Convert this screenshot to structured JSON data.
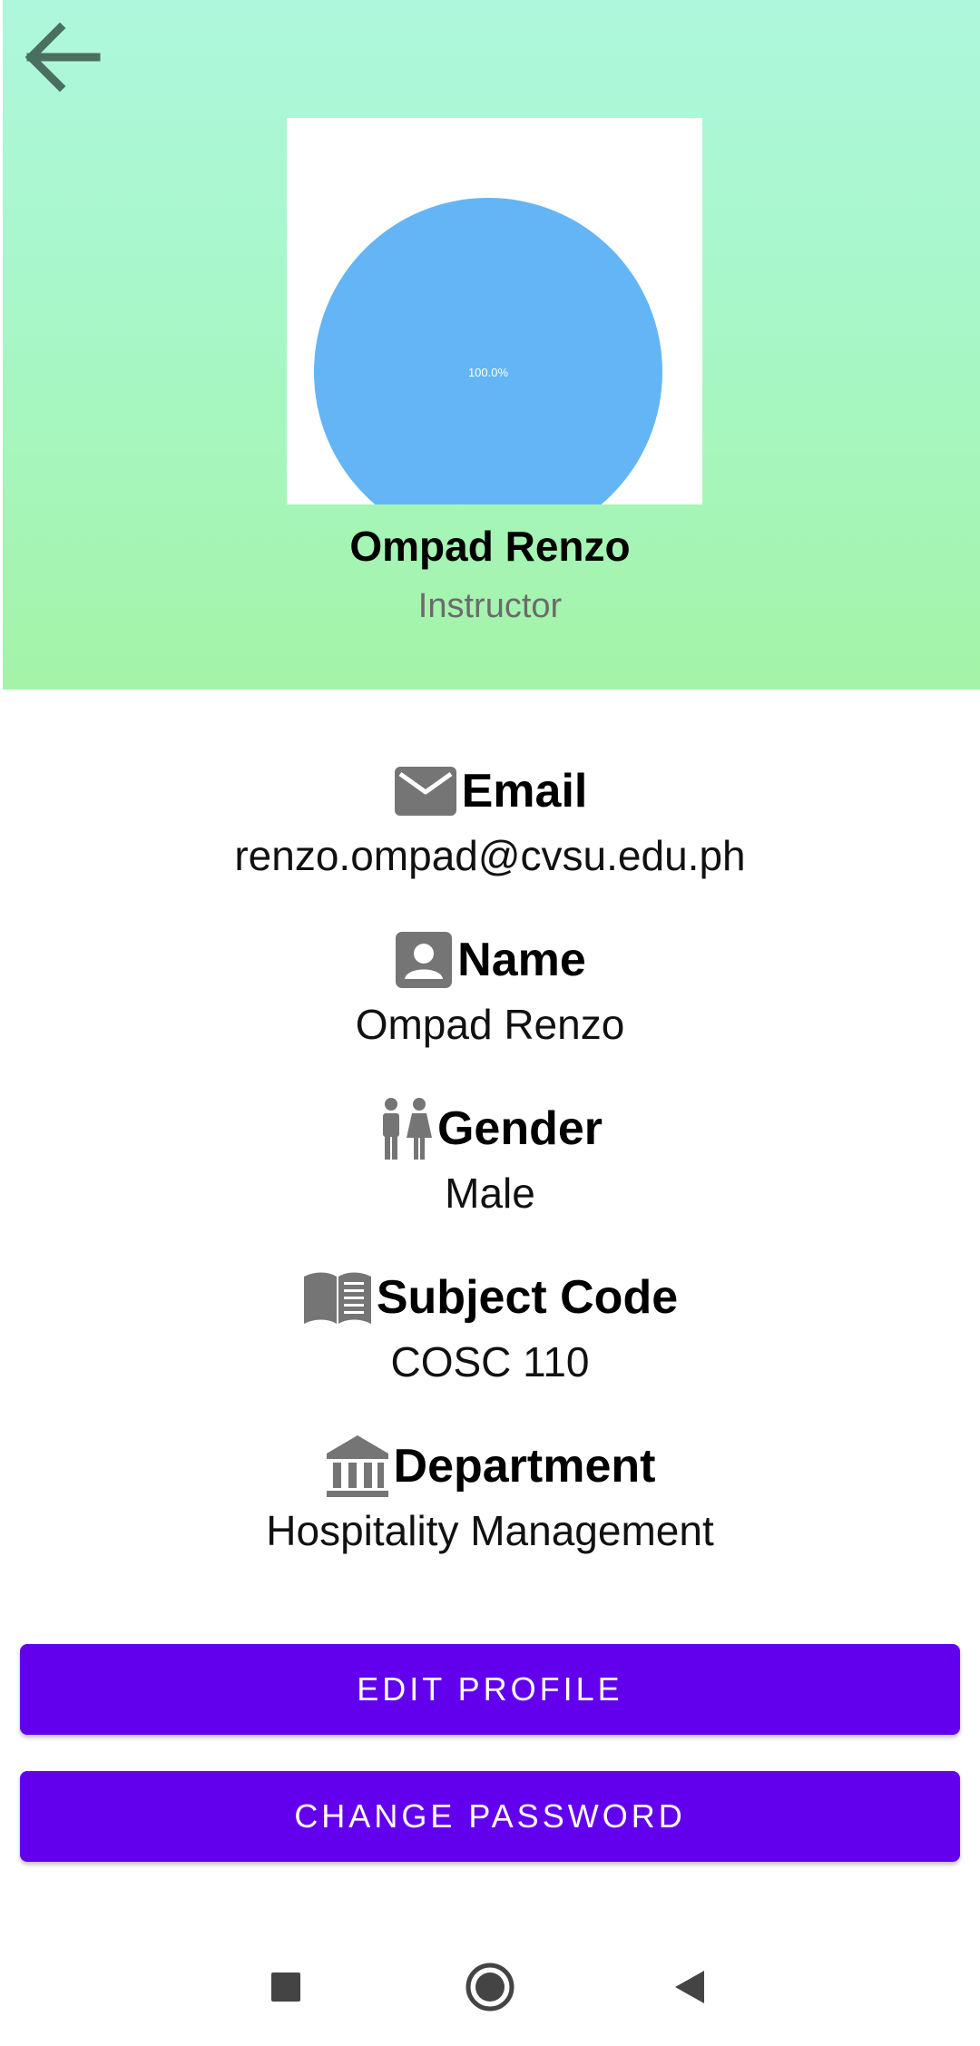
{
  "header": {
    "back_icon": "arrow-left-icon",
    "profile_name": "Ompad Renzo",
    "profile_role": "Instructor",
    "background_colors": [
      "#aef7dd",
      "#a4f3a8"
    ]
  },
  "chart_data": {
    "type": "pie",
    "slices": [
      {
        "value": 100.0,
        "label": "100.0%",
        "color": "#64b5f6"
      }
    ]
  },
  "info": {
    "email": {
      "icon": "mail-icon",
      "label": "Email",
      "value": "renzo.ompad@cvsu.edu.ph"
    },
    "name": {
      "icon": "account-box-icon",
      "label": "Name",
      "value": "Ompad Renzo"
    },
    "gender": {
      "icon": "wc-icon",
      "label": "Gender",
      "value": "Male"
    },
    "subject_code": {
      "icon": "book-icon",
      "label": "Subject Code",
      "value": "COSC 110"
    },
    "department": {
      "icon": "institution-icon",
      "label": "Department",
      "value": "Hospitality Management"
    }
  },
  "buttons": {
    "edit_profile": "EDIT PROFILE",
    "change_password": "CHANGE PASSWORD",
    "accent_color": "#6200ee"
  },
  "nav": {
    "recents_icon": "square-icon",
    "home_icon": "circle-icon",
    "back_icon": "triangle-back-icon"
  }
}
